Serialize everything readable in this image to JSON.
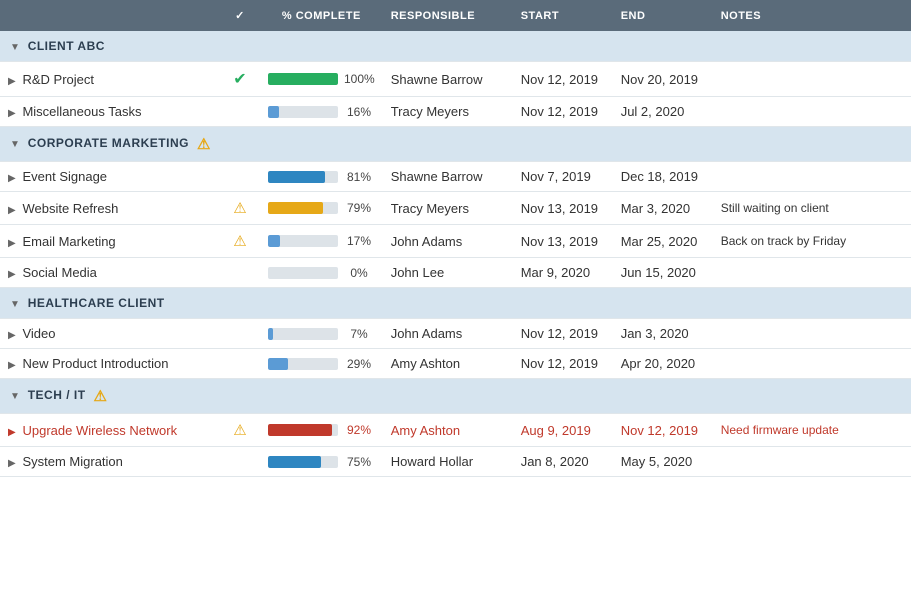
{
  "header": {
    "check_col": "✓",
    "complete_col": "% Complete",
    "responsible_col": "Responsible",
    "start_col": "Start",
    "end_col": "End",
    "notes_col": "Notes"
  },
  "groups": [
    {
      "id": "client-abc",
      "label": "CLIENT ABC",
      "warning": false,
      "tasks": [
        {
          "id": "rd-project",
          "name": "R&D Project",
          "check": "✔",
          "check_color": "green",
          "pct": 100,
          "bar_color": "#27ae60",
          "pct_label": "100%",
          "responsible": "Shawne Barrow",
          "start": "Nov 12, 2019",
          "end": "Nov 20, 2019",
          "notes": "",
          "overdue": false,
          "warning": false
        },
        {
          "id": "misc-tasks",
          "name": "Miscellaneous Tasks",
          "check": "",
          "check_color": "",
          "pct": 16,
          "bar_color": "#5b9bd5",
          "pct_label": "16%",
          "responsible": "Tracy Meyers",
          "start": "Nov 12, 2019",
          "end": "Jul 2, 2020",
          "notes": "",
          "overdue": false,
          "warning": false
        }
      ]
    },
    {
      "id": "corporate-marketing",
      "label": "CORPORATE MARKETING",
      "warning": true,
      "tasks": [
        {
          "id": "event-signage",
          "name": "Event Signage",
          "check": "",
          "check_color": "",
          "pct": 81,
          "bar_color": "#2e86c1",
          "pct_label": "81%",
          "responsible": "Shawne Barrow",
          "start": "Nov 7, 2019",
          "end": "Dec 18, 2019",
          "notes": "",
          "overdue": false,
          "warning": false
        },
        {
          "id": "website-refresh",
          "name": "Website Refresh",
          "check": "",
          "check_color": "",
          "pct": 79,
          "bar_color": "#e6a817",
          "pct_label": "79%",
          "responsible": "Tracy Meyers",
          "start": "Nov 13, 2019",
          "end": "Mar 3, 2020",
          "notes": "Still waiting on client",
          "overdue": false,
          "warning": true
        },
        {
          "id": "email-marketing",
          "name": "Email Marketing",
          "check": "",
          "check_color": "",
          "pct": 17,
          "bar_color": "#5b9bd5",
          "pct_label": "17%",
          "responsible": "John Adams",
          "start": "Nov 13, 2019",
          "end": "Mar 25, 2020",
          "notes": "Back on track by Friday",
          "overdue": false,
          "warning": true
        },
        {
          "id": "social-media",
          "name": "Social Media",
          "check": "",
          "check_color": "",
          "pct": 0,
          "bar_color": "#bfc9d0",
          "pct_label": "0%",
          "responsible": "John Lee",
          "start": "Mar 9, 2020",
          "end": "Jun 15, 2020",
          "notes": "",
          "overdue": false,
          "warning": false
        }
      ]
    },
    {
      "id": "healthcare-client",
      "label": "HEALTHCARE CLIENT",
      "warning": false,
      "tasks": [
        {
          "id": "video",
          "name": "Video",
          "check": "",
          "check_color": "",
          "pct": 7,
          "bar_color": "#5b9bd5",
          "pct_label": "7%",
          "responsible": "John Adams",
          "start": "Nov 12, 2019",
          "end": "Jan 3, 2020",
          "notes": "",
          "overdue": false,
          "warning": false
        },
        {
          "id": "new-product-intro",
          "name": "New Product Introduction",
          "check": "",
          "check_color": "",
          "pct": 29,
          "bar_color": "#5b9bd5",
          "pct_label": "29%",
          "responsible": "Amy Ashton",
          "start": "Nov 12, 2019",
          "end": "Apr 20, 2020",
          "notes": "",
          "overdue": false,
          "warning": false
        }
      ]
    },
    {
      "id": "tech-it",
      "label": "TECH / IT",
      "warning": true,
      "tasks": [
        {
          "id": "upgrade-wireless",
          "name": "Upgrade Wireless Network",
          "check": "",
          "check_color": "",
          "pct": 92,
          "bar_color": "#c0392b",
          "pct_label": "92%",
          "responsible": "Amy Ashton",
          "start": "Aug 9, 2019",
          "end": "Nov 12, 2019",
          "notes": "Need firmware update",
          "overdue": true,
          "warning": true
        },
        {
          "id": "system-migration",
          "name": "System Migration",
          "check": "",
          "check_color": "",
          "pct": 75,
          "bar_color": "#2e86c1",
          "pct_label": "75%",
          "responsible": "Howard Hollar",
          "start": "Jan 8, 2020",
          "end": "May 5, 2020",
          "notes": "",
          "overdue": false,
          "warning": false
        }
      ]
    }
  ]
}
